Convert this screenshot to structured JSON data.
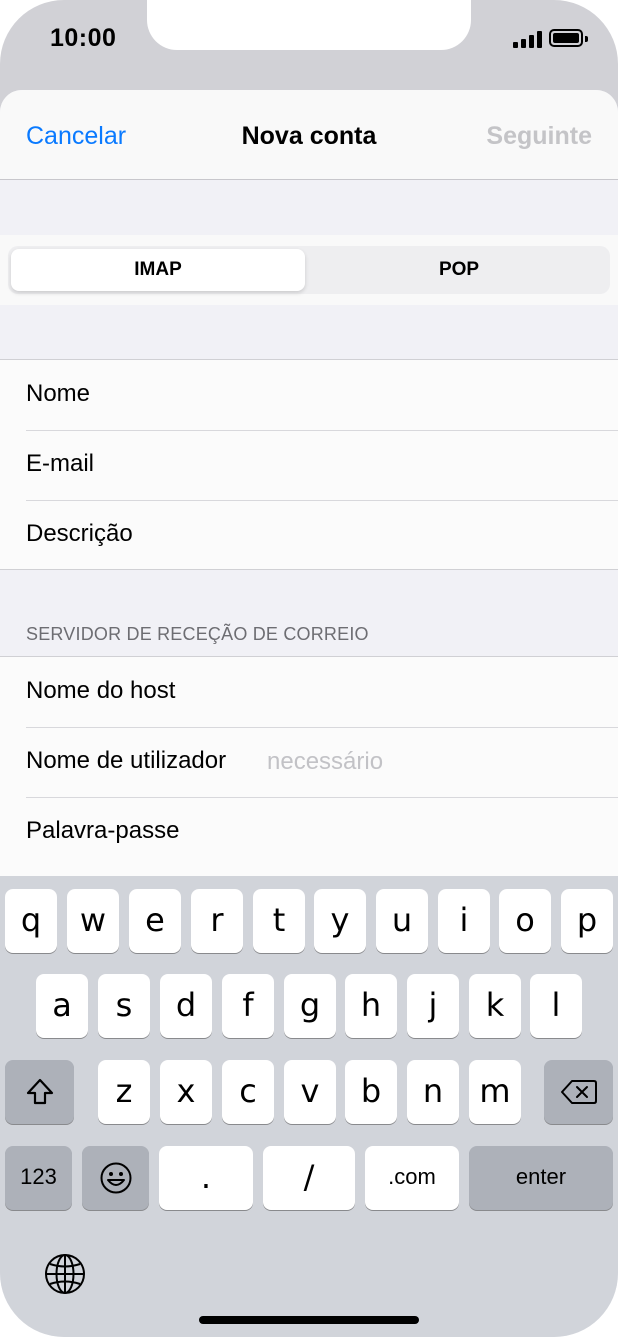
{
  "status_bar": {
    "time": "10:00"
  },
  "nav": {
    "cancel": "Cancelar",
    "title": "Nova conta",
    "next": "Seguinte"
  },
  "segments": {
    "selected": "IMAP",
    "other": "POP"
  },
  "account_fields": [
    {
      "label": "Nome"
    },
    {
      "label": "E-mail"
    },
    {
      "label": "Descrição"
    }
  ],
  "incoming_server": {
    "header": "SERVIDOR DE RECEÇÃO DE CORREIO",
    "fields": [
      {
        "label": "Nome do host",
        "placeholder": ""
      },
      {
        "label": "Nome de utilizador",
        "placeholder": "necessário"
      },
      {
        "label": "Palavra-passe",
        "placeholder": ""
      }
    ]
  },
  "keyboard": {
    "row1": [
      "q",
      "w",
      "e",
      "r",
      "t",
      "y",
      "u",
      "i",
      "o",
      "p"
    ],
    "row2": [
      "a",
      "s",
      "d",
      "f",
      "g",
      "h",
      "j",
      "k",
      "l"
    ],
    "row3": [
      "z",
      "x",
      "c",
      "v",
      "b",
      "n",
      "m"
    ],
    "numbers": "123",
    "dot": ".",
    "slash": "/",
    "dotcom": ".com",
    "enter": "enter",
    "icons": [
      "shift-icon",
      "backspace-icon",
      "emoji-icon",
      "globe-icon"
    ]
  },
  "colors": {
    "accent": "#0a7aff",
    "disabled": "#c4c4c7",
    "keyboard_bg": "#d1d4da"
  }
}
